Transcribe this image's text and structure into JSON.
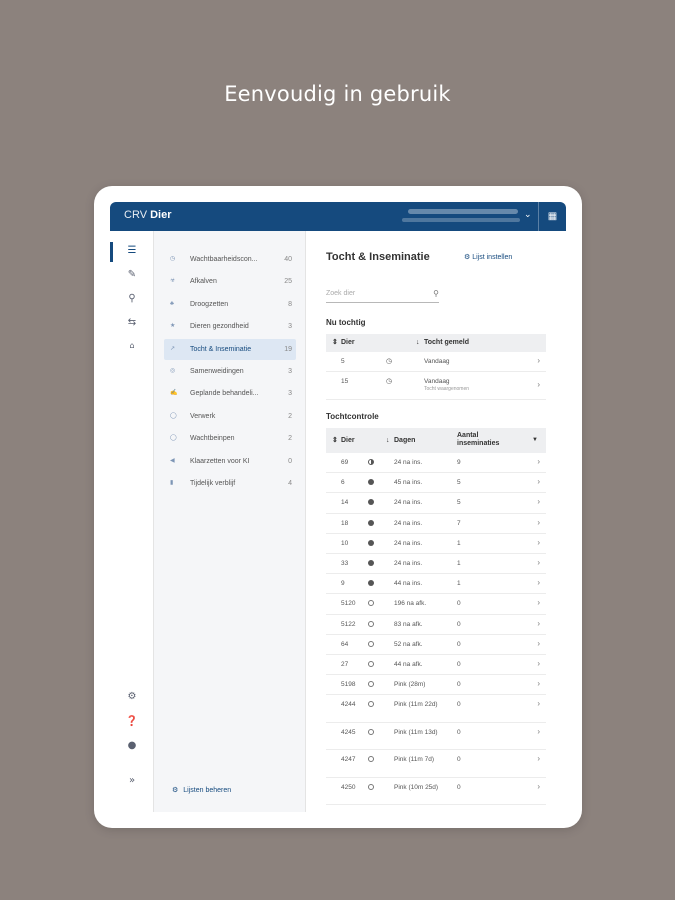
{
  "headline": "Eenvoudig in gebruik",
  "app": {
    "brand_prefix": "CRV",
    "brand_name": "Dier"
  },
  "rail": {
    "icons": [
      "list-icon",
      "pencil-icon",
      "search-icon",
      "transfer-icon",
      "barn-icon"
    ],
    "bottom_icons": [
      "gear-icon",
      "help-icon",
      "chat-icon",
      "expand-icon"
    ]
  },
  "menu": {
    "items": [
      {
        "label": "Wachtbaarheidscon...",
        "count": "40",
        "icon": "clock-icon"
      },
      {
        "label": "Afkalven",
        "count": "25",
        "icon": "calving-icon"
      },
      {
        "label": "Droogzetten",
        "count": "8",
        "icon": "dry-icon"
      },
      {
        "label": "Dieren gezondheid",
        "count": "3",
        "icon": "health-icon"
      },
      {
        "label": "Tocht & Inseminatie",
        "count": "19",
        "icon": "heat-icon",
        "active": true
      },
      {
        "label": "Samenweidingen",
        "count": "3",
        "icon": "group-icon"
      },
      {
        "label": "Geplande behandeli...",
        "count": "3",
        "icon": "syringe-icon"
      },
      {
        "label": "Verwerk",
        "count": "2",
        "icon": "process-icon"
      },
      {
        "label": "Wachtbeinpen",
        "count": "2",
        "icon": "wait-icon"
      },
      {
        "label": "Klaarzetten voor KI",
        "count": "0",
        "icon": "ai-icon"
      },
      {
        "label": "Tijdelijk verblijf",
        "count": "4",
        "icon": "stay-icon"
      }
    ],
    "manage_label": "Lijsten beheren"
  },
  "main": {
    "title": "Tocht & Inseminatie",
    "link": "Lijst instellen",
    "search_placeholder": "Zoek dier",
    "section1": "Nu tochtig",
    "table1": {
      "headers": [
        "Dier",
        "Tocht gemeld"
      ],
      "rows": [
        {
          "dier": "5",
          "when": "Vandaag",
          "sub": ""
        },
        {
          "dier": "15",
          "when": "Vandaag",
          "sub": "Tocht waargenomen"
        }
      ]
    },
    "section2": "Tochtcontrole",
    "table2": {
      "headers": [
        "Dier",
        "Dagen",
        "Aantal inseminaties"
      ],
      "rows": [
        {
          "dier": "69",
          "status": "partial",
          "dagen": "24 na ins.",
          "ins": "9"
        },
        {
          "dier": "6",
          "status": "full",
          "dagen": "45 na ins.",
          "ins": "5"
        },
        {
          "dier": "14",
          "status": "full",
          "dagen": "24 na ins.",
          "ins": "5"
        },
        {
          "dier": "18",
          "status": "full",
          "dagen": "24 na ins.",
          "ins": "7"
        },
        {
          "dier": "10",
          "status": "full",
          "dagen": "24 na ins.",
          "ins": "1"
        },
        {
          "dier": "33",
          "status": "full",
          "dagen": "24 na ins.",
          "ins": "1"
        },
        {
          "dier": "9",
          "status": "full",
          "dagen": "44 na ins.",
          "ins": "1"
        },
        {
          "dier": "5120",
          "status": "empty",
          "dagen": "196 na afk.",
          "ins": "0"
        },
        {
          "dier": "5122",
          "status": "empty",
          "dagen": "83 na afk.",
          "ins": "0"
        },
        {
          "dier": "64",
          "status": "empty",
          "dagen": "52 na afk.",
          "ins": "0"
        },
        {
          "dier": "27",
          "status": "empty",
          "dagen": "44 na afk.",
          "ins": "0"
        },
        {
          "dier": "5198",
          "status": "empty",
          "dagen": "Pink (28m)",
          "ins": "0"
        },
        {
          "dier": "4244",
          "status": "empty",
          "dagen": "Pink (11m 22d)",
          "ins": "0"
        },
        {
          "dier": "4245",
          "status": "empty",
          "dagen": "Pink (11m 13d)",
          "ins": "0"
        },
        {
          "dier": "4247",
          "status": "empty",
          "dagen": "Pink (11m 7d)",
          "ins": "0"
        },
        {
          "dier": "4250",
          "status": "empty",
          "dagen": "Pink (10m 25d)",
          "ins": "0"
        }
      ]
    }
  },
  "colors": {
    "brand": "#154a7e",
    "background": "#8c827d"
  }
}
